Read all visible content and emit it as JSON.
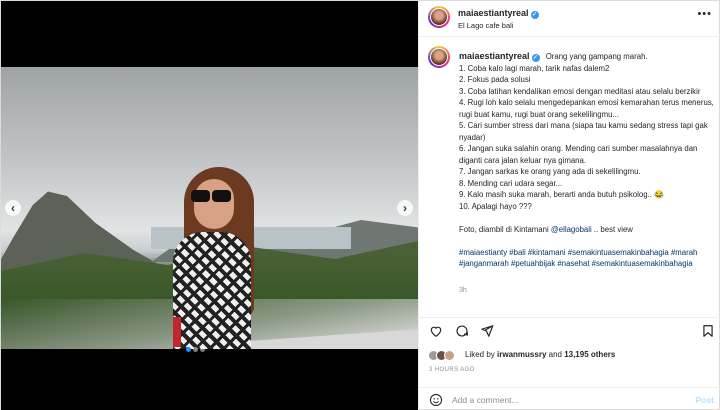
{
  "colors": {
    "accent": "#0095f6",
    "link": "#00376b",
    "muted": "#8e8e8e",
    "verified": "#3897f0"
  },
  "header": {
    "username": "maiaestiantyreal",
    "location": "El Lago cafe bali",
    "more_icon": "more-horizontal-icon"
  },
  "media": {
    "prev_icon": "chevron-left-icon",
    "next_icon": "chevron-right-icon",
    "slide_count": 3,
    "active_slide": 1
  },
  "caption": {
    "username": "maiaestiantyreal",
    "lead": "Orang yang gampang marah.",
    "lines": [
      "1. Coba kalo lagi marah, tarik nafas dalem2",
      "2. Fokus pada solusi",
      "3. Coba latihan kendalikan emosi dengan meditasi atau selalu berzikir",
      "4. Rugi loh kalo selalu mengedepankan emosi kemarahan terus menerus, rugi buat kamu, rugi buat orang sekelilingmu...",
      "5. Cari sumber stress dari mana (siapa tau kamu sedang stress tapi gak nyadar)",
      "6. Jangan suka salahin orang. Mending cari sumber masalahnya dan diganti cara jalan keluar nya gimana.",
      "7. Jangan sarkas ke orang yang ada di sekelilingmu.",
      "8. Mending cari udara segar...",
      "9. Kalo masih suka marah, berarti anda butuh psikolog.. 😂",
      "10. Apalagi hayo ???"
    ],
    "photo_credit_prefix": "Foto, diambil di Kintamani ",
    "photo_credit_mention": "@ellagobali",
    "photo_credit_suffix": " .. best view",
    "hashtags": "#maiaestianty #bali #kintamani #semakintuasemakinbahagia #marah #janganmarah #petuahbijak #nasehat #semakintuasemakinbahagia",
    "time": "3h"
  },
  "actions": {
    "like_icon": "heart-icon",
    "comment_icon": "comment-icon",
    "share_icon": "send-icon",
    "save_icon": "bookmark-icon"
  },
  "likes": {
    "prefix": "Liked by ",
    "user": "irwanmussry",
    "middle": " and ",
    "count": "13,195 others"
  },
  "posted": "3 HOURS AGO",
  "comment": {
    "emoji_icon": "smiley-icon",
    "placeholder": "Add a comment...",
    "post_label": "Post"
  }
}
